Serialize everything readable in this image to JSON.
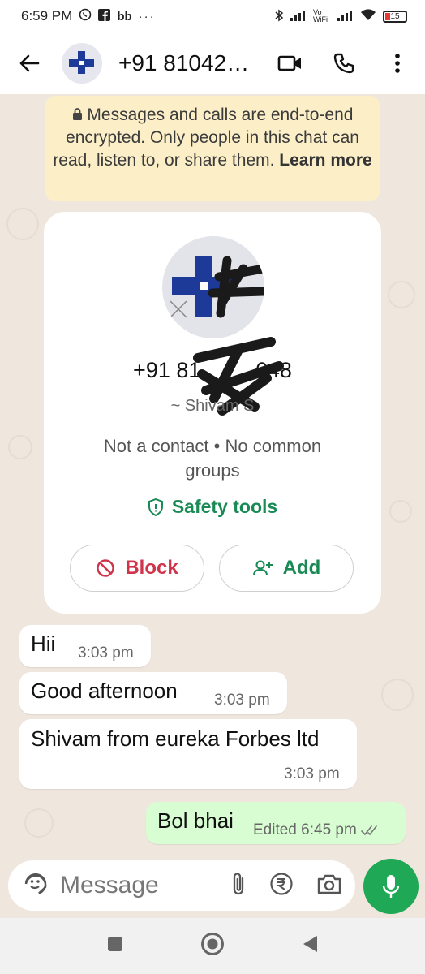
{
  "status_bar": {
    "time": "6:59 PM",
    "app_icons": [
      "whatsapp-icon",
      "facebook-icon",
      "bb-icon",
      "more-dots-icon"
    ],
    "vo_wifi": "Vo WiFi",
    "battery": "15"
  },
  "header": {
    "title": "+91 81042…",
    "back_icon": "arrow-left-icon",
    "video_icon": "video-call-icon",
    "call_icon": "phone-icon",
    "menu_icon": "more-vertical-icon"
  },
  "encryption_notice": {
    "text": "Messages and calls are end-to-end encrypted. Only people in this chat can read, listen to, or share them.",
    "link": "Learn more"
  },
  "contact_card": {
    "phone": "+91 81     648",
    "push_name": "~ Shivam S",
    "info": "Not a contact • No common groups",
    "safety_tools": "Safety tools",
    "block_label": "Block",
    "add_label": "Add"
  },
  "messages": [
    {
      "text": "Hii",
      "time": "3:03 pm",
      "direction": "in"
    },
    {
      "text": "Good afternoon",
      "time": "3:03 pm",
      "direction": "in"
    },
    {
      "text": "Shivam from eureka Forbes ltd",
      "time": "3:03 pm",
      "direction": "in"
    },
    {
      "text": "Bol bhai",
      "time": "6:45 pm",
      "edited": "Edited",
      "direction": "out",
      "status": "read"
    }
  ],
  "composer": {
    "placeholder": "Message"
  },
  "colors": {
    "accent": "#1fa855",
    "danger": "#d0344b",
    "outgoing_bubble": "#d9fdd3",
    "notice_bg": "#fcefc8"
  }
}
